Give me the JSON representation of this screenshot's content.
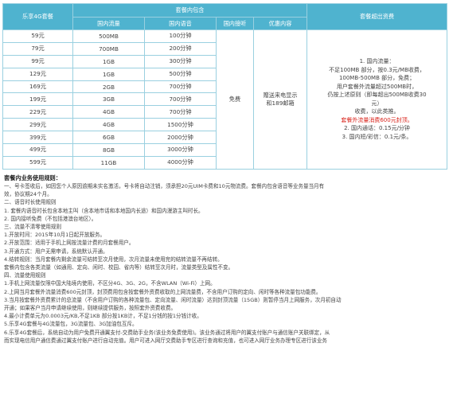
{
  "header": {
    "plan": "乐享4G套餐",
    "included": "套餐内包含",
    "overage": "套餐超出资费",
    "domestic_data": "国内流量",
    "domestic_voice": "国内语音",
    "incoming": "国内接听",
    "benefits": "优惠内容"
  },
  "plans": [
    {
      "price": "59元",
      "data": "500MB",
      "voice": "100分钟"
    },
    {
      "price": "79元",
      "data": "700MB",
      "voice": "200分钟"
    },
    {
      "price": "99元",
      "data": "1GB",
      "voice": "300分钟"
    },
    {
      "price": "129元",
      "data": "1GB",
      "voice": "500分钟"
    },
    {
      "price": "169元",
      "data": "2GB",
      "voice": "700分钟"
    },
    {
      "price": "199元",
      "data": "3GB",
      "voice": "700分钟"
    },
    {
      "price": "229元",
      "data": "4GB",
      "voice": "700分钟"
    },
    {
      "price": "299元",
      "data": "4GB",
      "voice": "1500分钟"
    },
    {
      "price": "399元",
      "data": "6GB",
      "voice": "2000分钟"
    },
    {
      "price": "499元",
      "data": "8GB",
      "voice": "3000分钟"
    },
    {
      "price": "599元",
      "data": "11GB",
      "voice": "4000分钟"
    }
  ],
  "incoming_value": "免费",
  "benefits_value": [
    "赠送来电显示",
    "和189邮箱"
  ],
  "overage_lines": [
    "1. 国内流量：",
    "不足100MB 部分，按0.3元/MB收费，",
    "100MB-500MB 部分，免费；",
    "用户套餐外流量超过500MB时，",
    "仍按上述原则（即每超出500MB收费30",
    "元）",
    "收费，以此类推。",
    "套餐外流量消费600元封顶。",
    "2. 国内通话：0.15元/分钟",
    "3. 国内短/彩信：0.1元/条。"
  ],
  "rules_title": "套餐内业务使用规则：",
  "rules": [
    "一、号卡签收后，如因您个人原因逾期未实名激活，号卡将自动注销，须承担20元UIM卡费和10元物流费。套餐内包含语音等业务量当月有",
    "效，协议期24个月。",
    "二、语音时长使用规则",
    "1. 套餐内语音时长包含本地主叫（含本地市话和本地国内长途）和国内漫游主叫时长。",
    "2. 国内接听免费（不包括港澳台地区）。",
    "三、流量不清零使用规则",
    "1.开放时间：2015年10月1日起开放服务。",
    "2.开放范围：适用于手机上网按流量计费的月套餐用户。",
    "3.开通方式：用户无需申请，系统默认开通。",
    "4.结转规则：当月套餐内剩余流量可结转至次月使用，次月流量未使用完的结转流量不再结转。",
    "套餐内包含各类流量（如通用、定向、闲时、校园、省内等）结转至次月时，流量类型及属性不变。",
    "四、流量使用规则",
    "1.手机上网流量仅限中国大陆境内使用，不区分4G、3G、2G，不含WLAN（Wi-Fi）上网。",
    "2.上网当月套餐外流量消费600元封顶，封顶费用包含按套餐外资费收取的上网流量费，不含用户订购的定向、闲时等各种流量包功能费。",
    "3.当月按套餐外资费累计的总流量（不含用户订购的各种流量包、定向流量、闲时流量）达到封顶流量（15GB）则暂停当月上网服务，次月初自动",
    "开通；如果客户当月申请继续使用，则继续提供服务，按照套外资费收费。",
    "4.最小计费单元为0.0003元/KB,不足1KB 部分按1KB计，不足1分钱的按1分钱计收。",
    "5.乐享4G套餐与4G流量包，3G流量包、3G加油包互斥。",
    "6.乐享4G套餐后，系统自动为用户免费开通翼支付-交费助手业务(该业务免费使用)。该业务通过将用户的翼支付账户与通信账户关联绑定，从",
    "而实现电信用户通信费通过翼支付账户进行自动充值。用户可进入网厅交费助手专区进行查询和充值，也可进入网厅业务办理专区进行该业务"
  ]
}
